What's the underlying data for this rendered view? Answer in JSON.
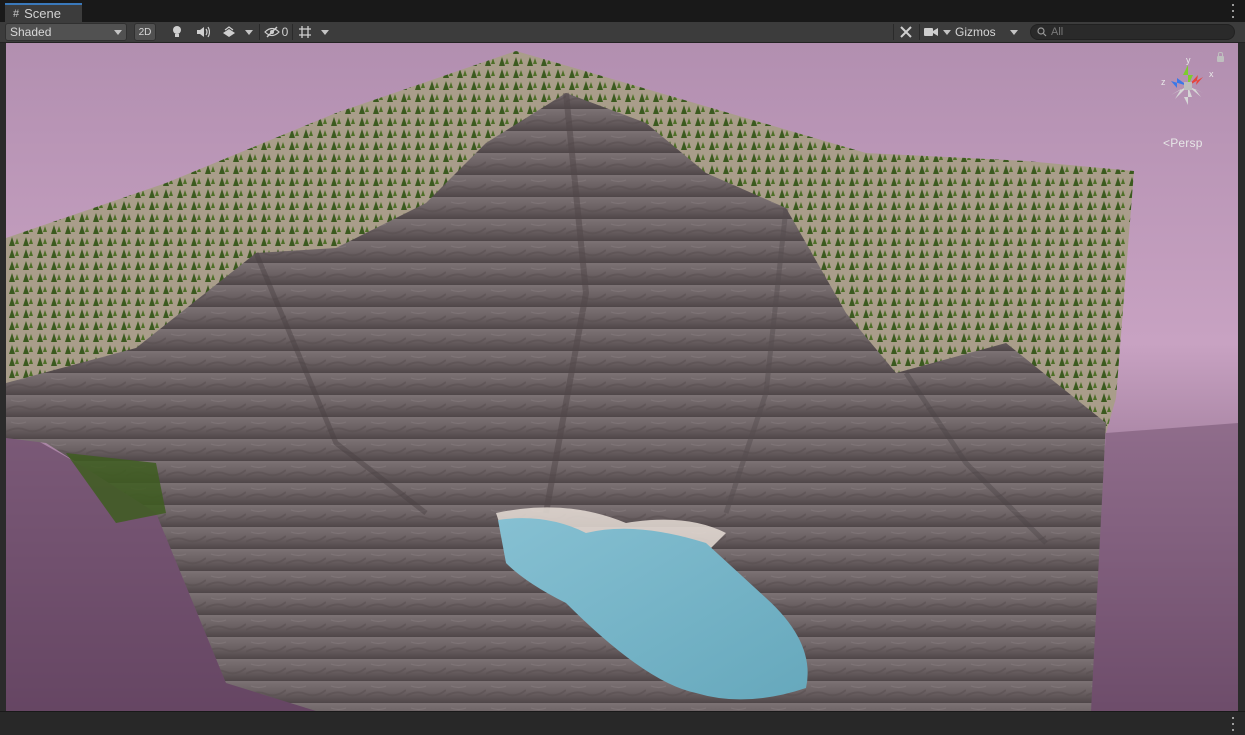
{
  "tab": {
    "title": "Scene",
    "icon": "grid-icon"
  },
  "toolbar": {
    "draw_mode": "Shaded",
    "mode_2d": "2D",
    "lighting_icon": "light-bulb-icon",
    "audio_icon": "speaker-icon",
    "effects_icon": "effects-icon",
    "hidden_icon": "eye-slash-icon",
    "hidden_count": "0",
    "grid_icon": "grid-snap-icon",
    "tools_icon": "tools-icon",
    "camera_icon": "camera-icon",
    "gizmos_label": "Gizmos",
    "search_placeholder": "All"
  },
  "viewport": {
    "projection_label": "Persp",
    "axis_labels": {
      "x": "x",
      "y": "y",
      "z": "z"
    },
    "colors": {
      "sky_top": "#b592b2",
      "sky_bottom": "#6e4a6b",
      "rock": "#6f6567",
      "forest": "#3f5e22",
      "sand": "#a89a86",
      "water": "#79b4c6",
      "gizmo_x": "#e8443a",
      "gizmo_y": "#7ccc2e",
      "gizmo_z": "#3a78e8"
    }
  }
}
